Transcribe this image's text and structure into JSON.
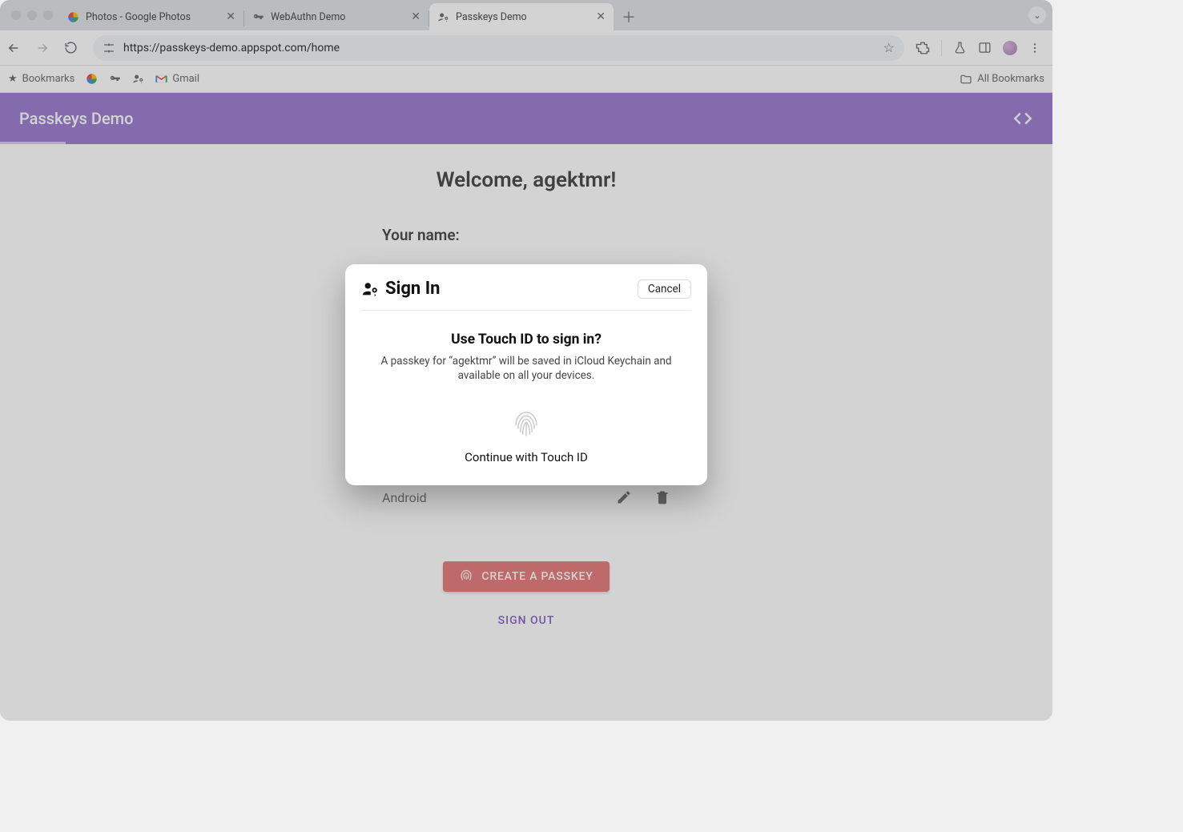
{
  "tabs": [
    {
      "title": "Photos - Google Photos",
      "active": false
    },
    {
      "title": "WebAuthn Demo",
      "active": false
    },
    {
      "title": "Passkeys Demo",
      "active": true
    }
  ],
  "address_bar": {
    "url": "https://passkeys-demo.appspot.com/home"
  },
  "bookmarks": {
    "label_bookmarks": "Bookmarks",
    "label_gmail": "Gmail",
    "label_all": "All Bookmarks"
  },
  "app": {
    "title": "Passkeys Demo"
  },
  "main": {
    "welcome": "Welcome, agektmr!",
    "name_label": "Your name:",
    "passkeys": [
      {
        "label": "Android"
      }
    ],
    "create_label": "CREATE A PASSKEY",
    "signout_label": "SIGN OUT"
  },
  "dialog": {
    "title": "Sign In",
    "cancel": "Cancel",
    "headline": "Use Touch ID to sign in?",
    "body": "A passkey for “agektmr” will be saved in iCloud Keychain and available on all your devices.",
    "continue": "Continue with Touch ID"
  }
}
